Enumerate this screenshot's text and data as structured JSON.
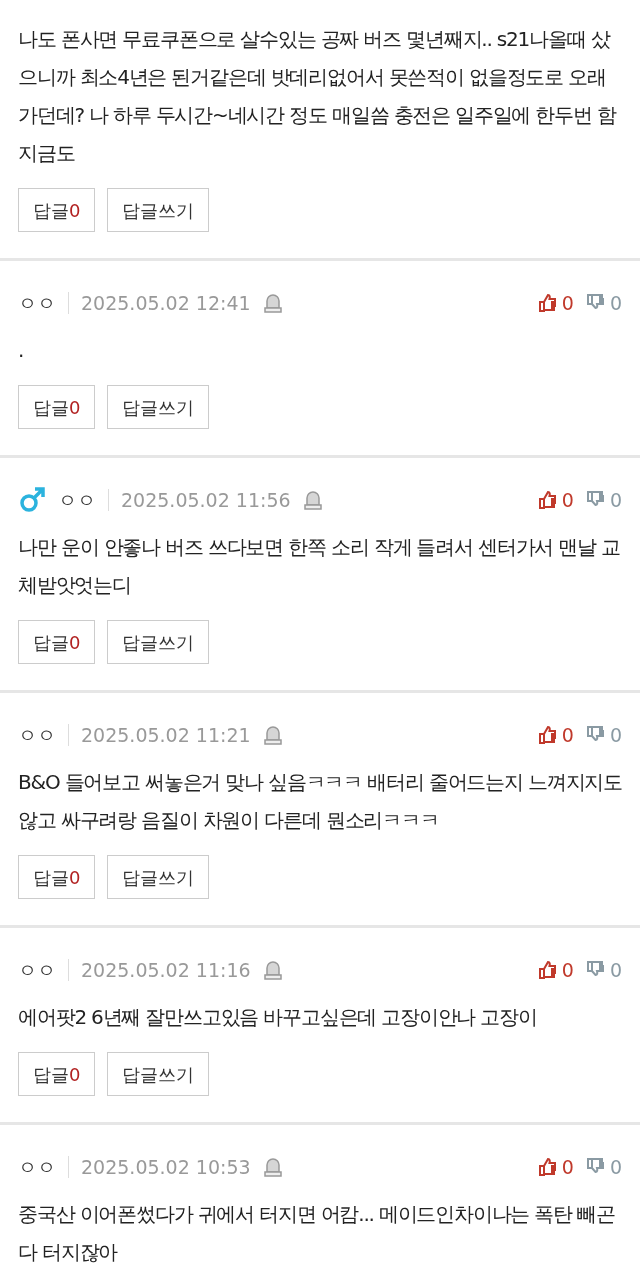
{
  "comments": [
    {
      "body": "나도 폰사면 무료쿠폰으로 살수있는 공짜 버즈 몇년째지.. s21나올때 샀으니까 최소4년은 된거같은데 밧데리없어서 못쓴적이 없을정도로 오래가던데? 나 하루 두시간~네시간 정도 매일씀 충전은 일주일에 한두번 함 지금도",
      "reply_label": "답글",
      "reply_count": "0",
      "write_label": "답글쓰기"
    },
    {
      "male": false,
      "nickname": "ㅇㅇ",
      "date": "2025.05.02 12:41",
      "likes": "0",
      "dislikes": "0",
      "body": ".",
      "reply_label": "답글",
      "reply_count": "0",
      "write_label": "답글쓰기"
    },
    {
      "male": true,
      "nickname": "ㅇㅇ",
      "date": "2025.05.02 11:56",
      "likes": "0",
      "dislikes": "0",
      "body": "나만 운이 안좋나 버즈 쓰다보면 한쪽 소리 작게 들려서 센터가서 맨날 교체받앗엇는디",
      "reply_label": "답글",
      "reply_count": "0",
      "write_label": "답글쓰기"
    },
    {
      "male": false,
      "nickname": "ㅇㅇ",
      "date": "2025.05.02 11:21",
      "likes": "0",
      "dislikes": "0",
      "body": "B&O 들어보고 써놓은거 맞나 싶음ㅋㅋㅋ 배터리 줄어드는지 느껴지지도 않고 싸구려랑 음질이 차원이 다른데 뭔소리ㅋㅋㅋ",
      "reply_label": "답글",
      "reply_count": "0",
      "write_label": "답글쓰기"
    },
    {
      "male": false,
      "nickname": "ㅇㅇ",
      "date": "2025.05.02 11:16",
      "likes": "0",
      "dislikes": "0",
      "body": "에어팟2 6년째 잘만쓰고있음 바꾸고싶은데 고장이안나 고장이",
      "reply_label": "답글",
      "reply_count": "0",
      "write_label": "답글쓰기"
    },
    {
      "male": false,
      "nickname": "ㅇㅇ",
      "date": "2025.05.02 10:53",
      "likes": "0",
      "dislikes": "0",
      "body": "중국산 이어폰썼다가 귀에서 터지면 어캄... 메이드인차이나는 폭탄 빼곤 다 터지잖아"
    }
  ]
}
